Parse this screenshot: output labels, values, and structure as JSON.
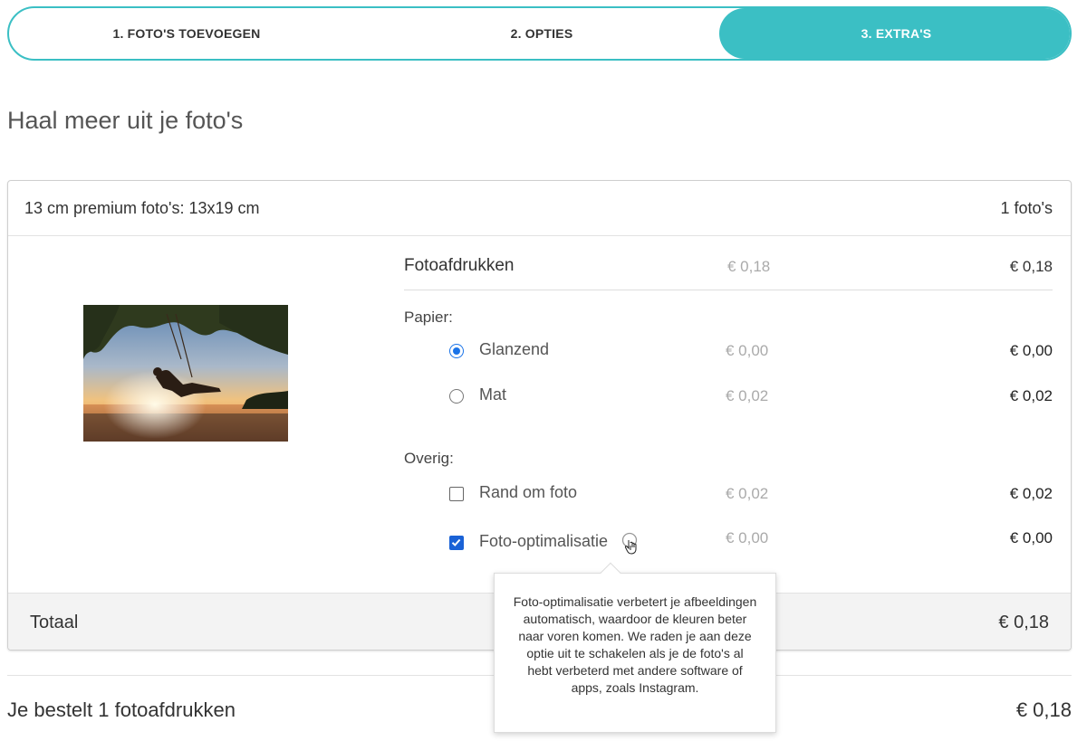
{
  "stepper": {
    "steps": [
      {
        "label": "1. FOTO'S TOEVOEGEN",
        "active": false
      },
      {
        "label": "2. OPTIES",
        "active": false
      },
      {
        "label": "3. EXTRA'S",
        "active": true
      }
    ],
    "accent": "#3bbfc4"
  },
  "page_title": "Haal meer uit je foto's",
  "card": {
    "product": "13 cm premium foto's: 13x19 cm",
    "count": "1 foto's",
    "main_option": {
      "label": "Fotoafdrukken",
      "unit_price": "€ 0,18",
      "total": "€ 0,18"
    },
    "paper": {
      "label": "Papier:",
      "options": [
        {
          "label": "Glanzend",
          "unit_price": "€ 0,00",
          "total": "€ 0,00",
          "selected": true
        },
        {
          "label": "Mat",
          "unit_price": "€ 0,02",
          "total": "€ 0,02",
          "selected": false
        }
      ]
    },
    "other": {
      "label": "Overig:",
      "options": [
        {
          "label": "Rand om foto",
          "unit_price": "€ 0,02",
          "total": "€ 0,02",
          "checked": false
        },
        {
          "label": "Foto-optimalisatie",
          "unit_price": "€ 0,00",
          "total": "€ 0,00",
          "checked": true,
          "icon": "info-icon"
        }
      ]
    },
    "total_label": "Totaal",
    "total_value": "€ 0,18"
  },
  "summary": {
    "text": "Je bestelt 1 fotoafdrukken",
    "price": "€ 0,18"
  },
  "tooltip": {
    "text": "Foto-optimalisatie verbetert je afbeeldingen automatisch, waardoor de kleuren beter naar voren komen. We raden je aan deze optie uit te schakelen als je de foto's al hebt verbeterd met andere software of apps, zoals Instagram."
  },
  "colors": {
    "accent": "#3bbfc4",
    "checkbox_blue": "#1a62d6",
    "radio_blue": "#1a73e8"
  }
}
